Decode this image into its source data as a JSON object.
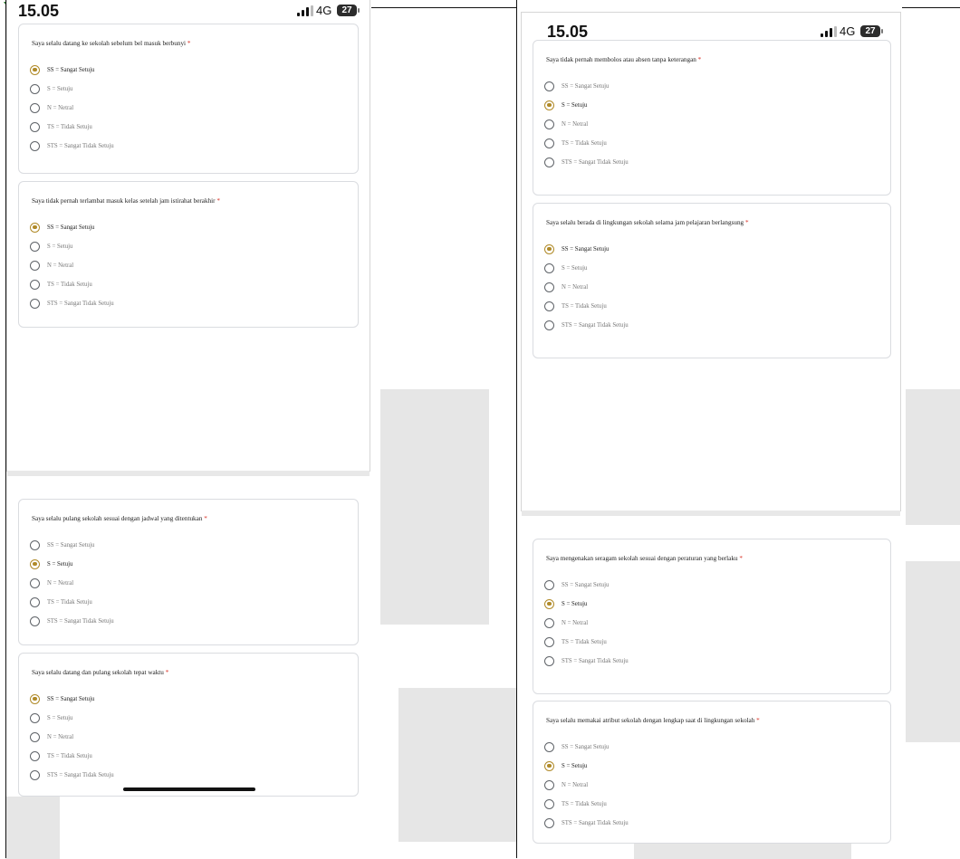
{
  "status_bar": {
    "time": "15.05",
    "network": "4G",
    "battery": "27"
  },
  "questions": [
    {
      "text": "Saya selalu datang ke sekolah sebelum bel masuk berbunyi",
      "selected": 0
    },
    {
      "text": "Saya tidak pernah terlambat masuk kelas setelah jam istirahat berakhir",
      "selected": 0
    },
    {
      "text": "Saya selalu pulang sekolah sesuai dengan jadwal yang ditentukan",
      "selected": 1
    },
    {
      "text": "Saya selalu datang dan pulang sekolah tepat waktu",
      "selected": 0
    },
    {
      "text": "Saya tidak pernah membolos atau absen tanpa keterangan",
      "selected": 1
    },
    {
      "text": "Saya selalu berada di lingkungan sekolah selama jam pelajaran berlangsung",
      "selected": 0
    },
    {
      "text": "Saya mengenakan seragam sekolah sesuai dengan peraturan yang berlaku",
      "selected": 1
    },
    {
      "text": "Saya selalu memakai atribut sekolah dengan lengkap saat di lingkungan sekolah",
      "selected": 1
    }
  ],
  "required_mark": "*",
  "options": [
    "SS = Sangat Setuju",
    "S = Setuju",
    "N = Netral",
    "TS = Tidak Setuju",
    "STS = Sangat Tidak Setuju"
  ],
  "colors": {
    "accent": "#b08a28",
    "required": "#d93025",
    "watermark": "#e6e6e6"
  }
}
